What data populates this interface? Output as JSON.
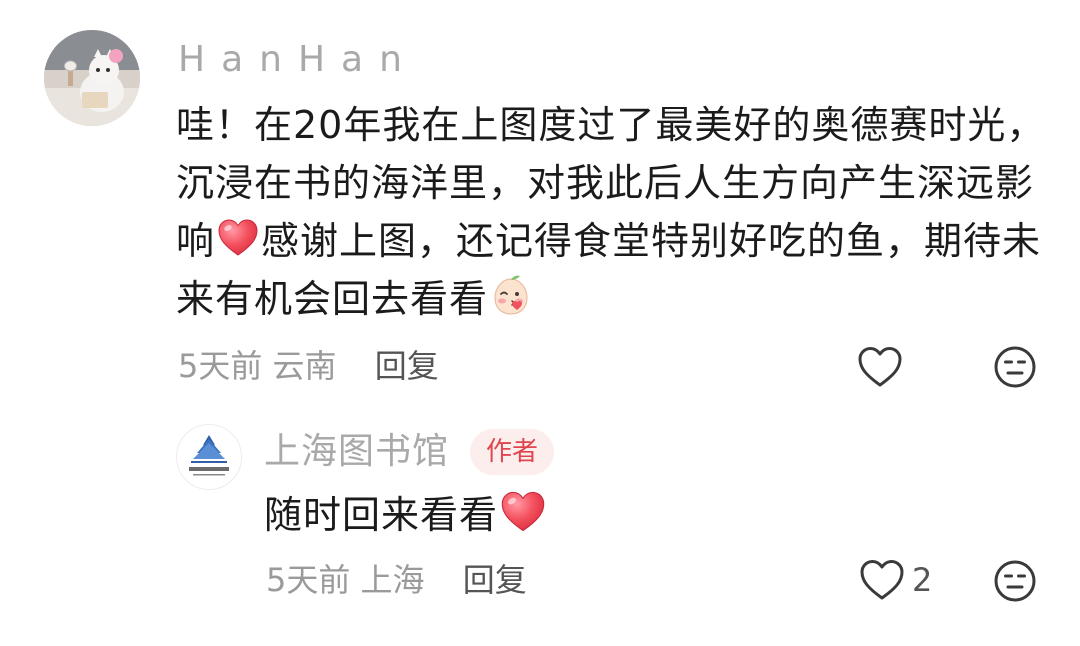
{
  "comment": {
    "username": "HanHan",
    "text_lines": [
      "哇！在20年我在上图度过了最美好的奥德赛时光，",
      "沉浸在书的海洋里，对我此后人生方向产生深远影",
      "响",
      "感谢上图，还记得食堂特别好吃的鱼，期待未",
      "来有机会回去看看"
    ],
    "emojis": [
      "red-heart-emoji",
      "blushing-peach-emoji"
    ],
    "time": "5天前",
    "location": "云南",
    "reply_label": "回复",
    "icons": [
      "heart-outline-icon",
      "neutral-face-icon"
    ]
  },
  "reply": {
    "author": "上海图书馆",
    "badge": "作者",
    "text": "随时回来看看",
    "emoji": "red-heart-emoji",
    "time": "5天前",
    "location": "上海",
    "reply_label": "回复",
    "like_count": "2",
    "icons": [
      "heart-outline-icon",
      "neutral-face-icon"
    ]
  },
  "colors": {
    "muted_text": "#9a9a9a",
    "badge_bg": "#fdeeee",
    "badge_text": "#e0464e",
    "heart_red": "#f0515f"
  }
}
